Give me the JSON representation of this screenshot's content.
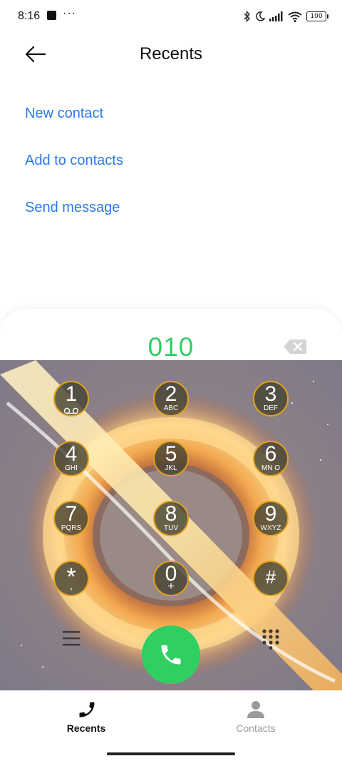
{
  "status_bar": {
    "time": "8:16",
    "dots": "···",
    "battery": "100"
  },
  "header": {
    "title": "Recents"
  },
  "actions": [
    {
      "label": "New contact"
    },
    {
      "label": "Add to contacts"
    },
    {
      "label": "Send message"
    }
  ],
  "dialer": {
    "number": "010",
    "keys": [
      {
        "digit": "1",
        "letters": ""
      },
      {
        "digit": "2",
        "letters": "ABC"
      },
      {
        "digit": "3",
        "letters": "DEF"
      },
      {
        "digit": "4",
        "letters": "GHI"
      },
      {
        "digit": "5",
        "letters": "JKL"
      },
      {
        "digit": "6",
        "letters": "MN O"
      },
      {
        "digit": "7",
        "letters": "PQRS"
      },
      {
        "digit": "8",
        "letters": "TUV"
      },
      {
        "digit": "9",
        "letters": "WXYZ"
      },
      {
        "digit": "*",
        "letters": ","
      },
      {
        "digit": "0",
        "letters": "+"
      },
      {
        "digit": "#",
        "letters": ""
      }
    ]
  },
  "bottom_nav": {
    "items": [
      {
        "label": "Recents",
        "icon": "phone-icon",
        "active": true
      },
      {
        "label": "Contacts",
        "icon": "person-icon",
        "active": false
      }
    ]
  },
  "colors": {
    "accent_link": "#2a7ce9",
    "dial_green": "#2fcf62",
    "key_ring": "#e2a21e"
  }
}
